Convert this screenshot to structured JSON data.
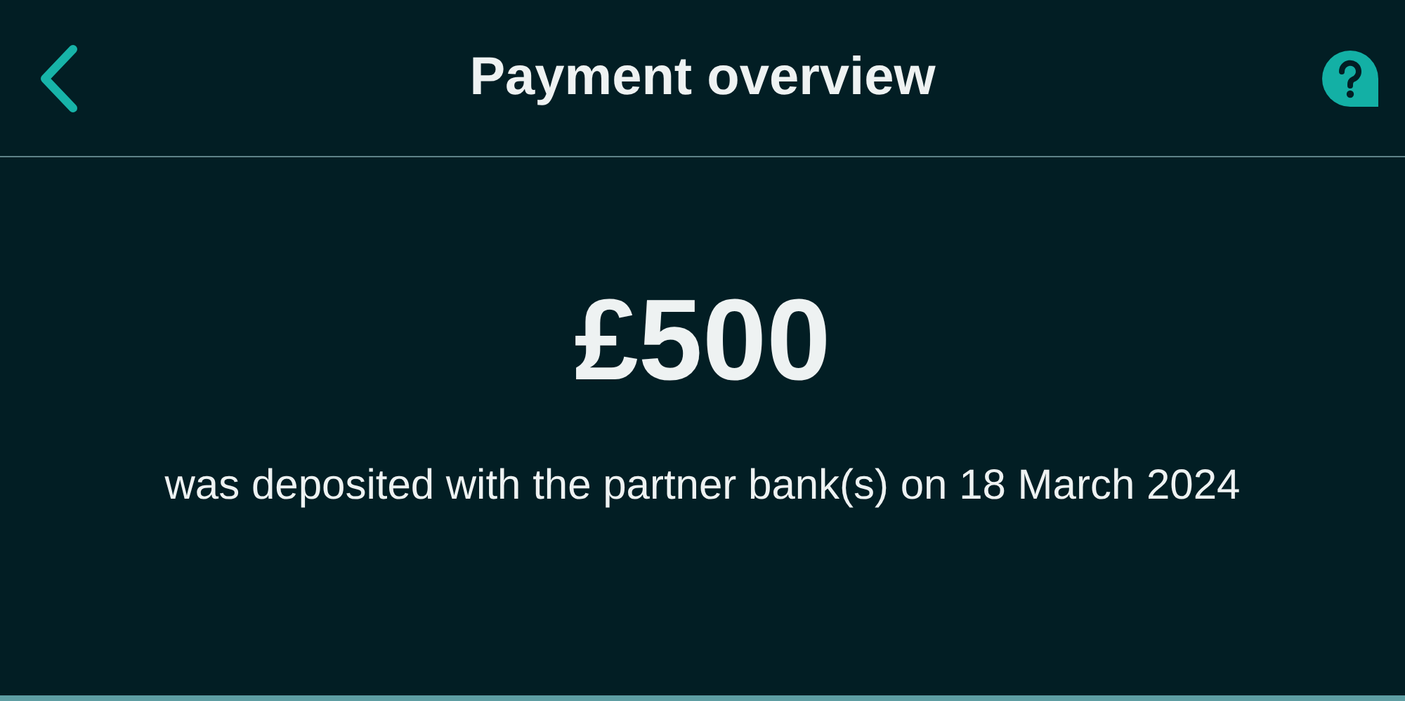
{
  "header": {
    "title": "Payment overview"
  },
  "amount": "£500",
  "description": "was deposited with the partner bank(s) on 18 March 2024"
}
